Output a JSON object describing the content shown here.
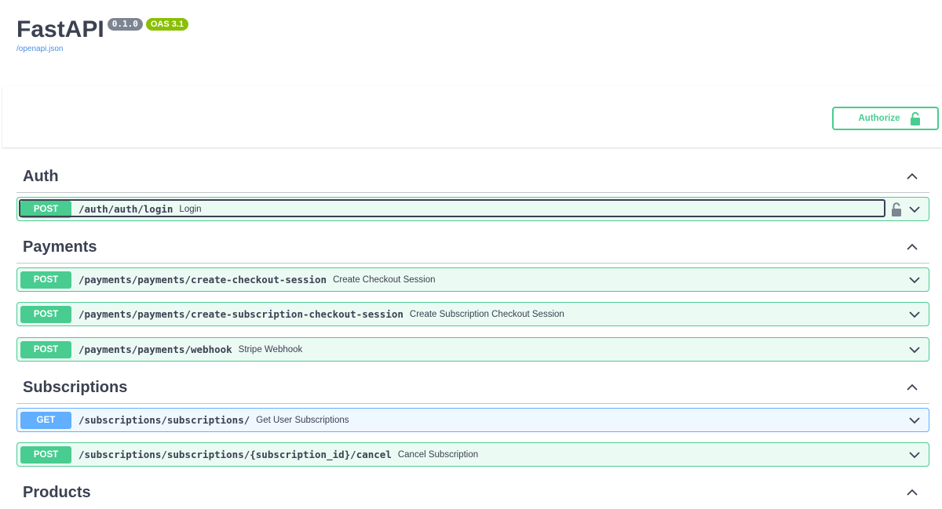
{
  "header": {
    "title": "FastAPI",
    "version": "0.1.0",
    "oas": "OAS 3.1",
    "spec_link": "/openapi.json"
  },
  "authorize": {
    "label": "Authorize",
    "icon": "unlocked-padlock-icon"
  },
  "colors": {
    "post": "#49cc90",
    "get": "#61affe",
    "text": "#3b4151",
    "link": "#4990e2"
  },
  "tags": [
    {
      "name": "Auth",
      "operations": [
        {
          "method": "POST",
          "path": "/auth/auth/login",
          "summary": "Login",
          "locked": true
        }
      ]
    },
    {
      "name": "Payments",
      "operations": [
        {
          "method": "POST",
          "path": "/payments/payments/create-checkout-session",
          "summary": "Create Checkout Session"
        },
        {
          "method": "POST",
          "path": "/payments/payments/create-subscription-checkout-session",
          "summary": "Create Subscription Checkout Session"
        },
        {
          "method": "POST",
          "path": "/payments/payments/webhook",
          "summary": "Stripe Webhook"
        }
      ]
    },
    {
      "name": "Subscriptions",
      "operations": [
        {
          "method": "GET",
          "path": "/subscriptions/subscriptions/",
          "summary": "Get User Subscriptions"
        },
        {
          "method": "POST",
          "path": "/subscriptions/subscriptions/{subscription_id}/cancel",
          "summary": "Cancel Subscription"
        }
      ]
    },
    {
      "name": "Products",
      "operations": []
    }
  ]
}
